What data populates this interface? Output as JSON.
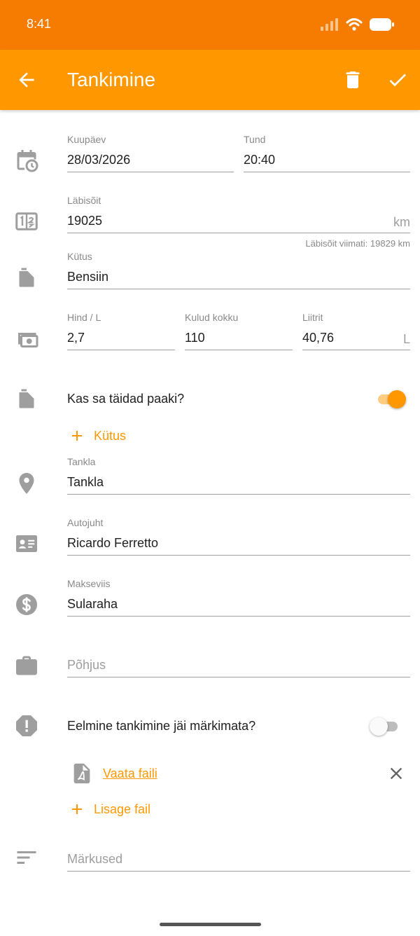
{
  "status": {
    "time": "8:41"
  },
  "app_bar": {
    "title": "Tankimine"
  },
  "date": {
    "label": "Kuupäev",
    "value": "28/03/2026"
  },
  "time": {
    "label": "Tund",
    "value": "20:40"
  },
  "odometer": {
    "label": "Läbisõit",
    "value": "19025",
    "unit": "km",
    "hint": "Läbisõit viimati: 19829 km"
  },
  "fuel": {
    "label": "Kütus",
    "value": "Bensiin"
  },
  "price": {
    "label": "Hind / L",
    "value": "2,7"
  },
  "total": {
    "label": "Kulud kokku",
    "value": "110"
  },
  "liters": {
    "label": "Liitrit",
    "value": "40,76",
    "unit": "L"
  },
  "full_tank": {
    "question": "Kas sa täidad paaki?",
    "checked": true
  },
  "add_fuel": {
    "label": "Kütus"
  },
  "station": {
    "label": "Tankla",
    "value": "Tankla"
  },
  "driver": {
    "label": "Autojuht",
    "value": "Ricardo Ferretto"
  },
  "payment": {
    "label": "Makseviis",
    "value": "Sularaha"
  },
  "reason": {
    "placeholder": "Põhjus"
  },
  "missed": {
    "question": "Eelmine tankimine jäi märkimata?",
    "checked": false
  },
  "attachment": {
    "link": "Vaata faili"
  },
  "add_file": {
    "label": "Lisage fail"
  },
  "notes": {
    "placeholder": "Märkused"
  },
  "colors": {
    "accent": "#FF9800",
    "status_bar": "#F57C00",
    "icon": "#9e9e9e"
  }
}
